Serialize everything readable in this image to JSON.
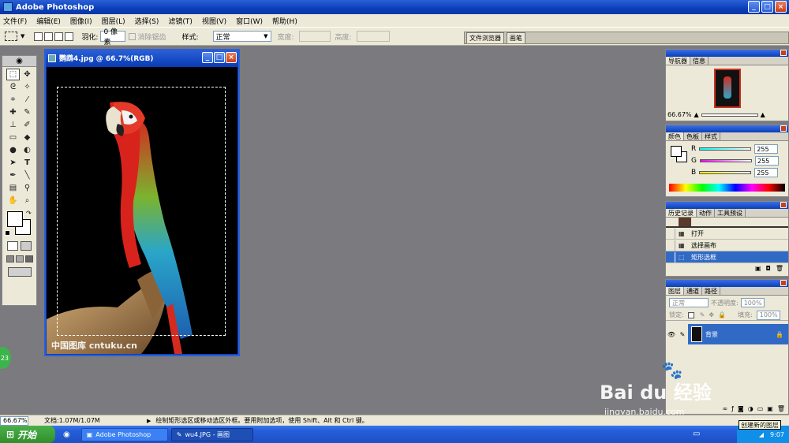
{
  "app": {
    "title": "Adobe Photoshop"
  },
  "window_buttons": {
    "minimize": "_",
    "maximize": "□",
    "close": "×"
  },
  "menu": [
    "文件(F)",
    "编辑(E)",
    "图像(I)",
    "图层(L)",
    "选择(S)",
    "滤镜(T)",
    "视图(V)",
    "窗口(W)",
    "帮助(H)"
  ],
  "options": {
    "feather_label": "羽化:",
    "feather_value": "0 像素",
    "antialias_label": "消除锯齿",
    "style_label": "样式:",
    "style_value": "正常",
    "width_label": "宽度:",
    "height_label": "高度:"
  },
  "well_tabs": [
    "文件浏览器",
    "画笔"
  ],
  "document": {
    "title": "鹦鹉4.jpg @ 66.7%(RGB)"
  },
  "image_watermark": "中国图库 cntuku.cn",
  "navigator": {
    "tabs": [
      "导航器",
      "信息"
    ],
    "zoom": "66.67%"
  },
  "color": {
    "tabs": [
      "颜色",
      "色板",
      "样式"
    ],
    "r_label": "R",
    "g_label": "G",
    "b_label": "B",
    "r": "255",
    "g": "255",
    "b": "255"
  },
  "history": {
    "tabs": [
      "历史记录",
      "动作",
      "工具预设"
    ],
    "items": [
      "打开",
      "选择画布",
      "矩形选框"
    ]
  },
  "layers": {
    "tabs": [
      "图层",
      "通道",
      "路径"
    ],
    "blend_mode": "正常",
    "opacity_label": "不透明度:",
    "opacity": "100%",
    "lock_label": "锁定:",
    "fill_label": "填充:",
    "fill": "100%",
    "layer_name": "背景"
  },
  "tooltip": "创建新的图层",
  "status": {
    "zoom": "66.67%",
    "doc_info": "文档:1.07M/1.07M",
    "hint": "绘制矩形选区或移动选区外框。要用附加选项，使用 Shift、Alt 和 Ctrl 键。"
  },
  "taskbar": {
    "start": "开始",
    "tasks": [
      "Adobe Photoshop",
      "wu4.JPG - 画图"
    ],
    "time": "9:07"
  },
  "side_badge": "23",
  "baidu": {
    "logo": "Bai du 经验",
    "url": "jingyan.baidu.com"
  }
}
